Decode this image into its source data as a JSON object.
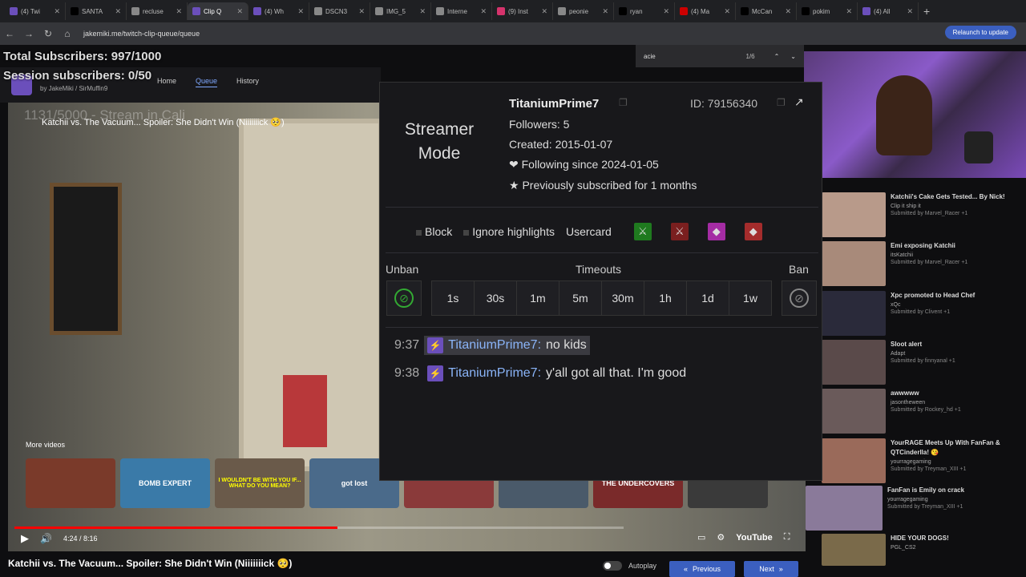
{
  "browser": {
    "tabs": [
      "(4) Twi",
      "SANTA",
      "recluse",
      "Clip Q",
      "(4) Wh",
      "DSCN3",
      "IMG_5",
      "Interne",
      "(9) Inst",
      "peonie",
      "ryan",
      "(4) Ma",
      "McCan",
      "pokim",
      "(4) All"
    ],
    "url": "jakemiki.me/twitch-clip-queue/queue",
    "relaunch": "Relaunch to update",
    "find_query": "acie",
    "find_count": "1/6"
  },
  "overlay": {
    "total_subs": "Total Subscribers: 997/1000",
    "session_subs": "Session subscribers: 0/50"
  },
  "site": {
    "nav": [
      "Home",
      "Queue",
      "History"
    ],
    "byline": "by JakeMiki / SirMuffin9"
  },
  "video": {
    "title": "Katchii vs. The Vacuum... Spoiler: She Didn't Win (Niiiiiiick 🥺)",
    "overlay_text": "1131/5000 - Stream in Cali",
    "more_videos": "More videos",
    "thumbs": [
      "",
      "BOMB EXPERT",
      "I WOULDN'T BE WITH YOU IF... WHAT DO YOU MEAN?",
      "got lost",
      "",
      "",
      "THE UNDERCOVERS",
      ""
    ],
    "time": "4:24 / 8:16",
    "progress": 0.53,
    "youtube": "YouTube",
    "autoplay": "Autoplay",
    "previous": "Previous",
    "next": "Next"
  },
  "usercard": {
    "streamer_mode_1": "Streamer",
    "streamer_mode_2": "Mode",
    "username": "TitaniumPrime7",
    "id": "ID: 79156340",
    "followers": "Followers: 5",
    "created": "Created: 2015-01-07",
    "following": "❤ Following since 2024-01-05",
    "subscribed": "★ Previously subscribed for 1 months",
    "block": "Block",
    "ignore": "Ignore highlights",
    "usercard": "Usercard",
    "unban": "Unban",
    "timeouts": "Timeouts",
    "ban": "Ban",
    "durations": [
      "1s",
      "30s",
      "1m",
      "5m",
      "30m",
      "1h",
      "1d",
      "1w"
    ],
    "messages": [
      {
        "time": "9:37",
        "user": "TitaniumPrime7:",
        "text": "no kids"
      },
      {
        "time": "9:38",
        "user": "TitaniumPrime7:",
        "text": "y'all got all that. I'm good"
      }
    ]
  },
  "clips": [
    {
      "title": "Katchii's Cake Gets Tested... By Nick!",
      "channel": "Clip it ship it",
      "by": "Submitted by Marvel_Racer +1"
    },
    {
      "title": "Emi exposing Katchii",
      "channel": "itsKatchii",
      "by": "Submitted by Marvel_Racer +1"
    },
    {
      "title": "Xpc promoted to Head Chef",
      "channel": "xQc",
      "by": "Submitted by Clivent +1"
    },
    {
      "title": "Sloot alert",
      "channel": "Adapt",
      "by": "Submitted by finnyanal +1"
    },
    {
      "title": "awwwww",
      "channel": "jasontheween",
      "by": "Submitted by Rockey_hd +1"
    },
    {
      "title": "YourRAGE Meets Up With FanFan & QTCinderlla! 😘",
      "channel": "yourragegaming",
      "by": "Submitted by Treyman_XIII +1"
    },
    {
      "title": "FanFan is Emily on crack",
      "channel": "yourragegaming",
      "by": "Submitted by Treyman_XIII +1"
    },
    {
      "title": "HIDE YOUR DOGS!",
      "channel": "PGL_CS2",
      "by": ""
    }
  ]
}
